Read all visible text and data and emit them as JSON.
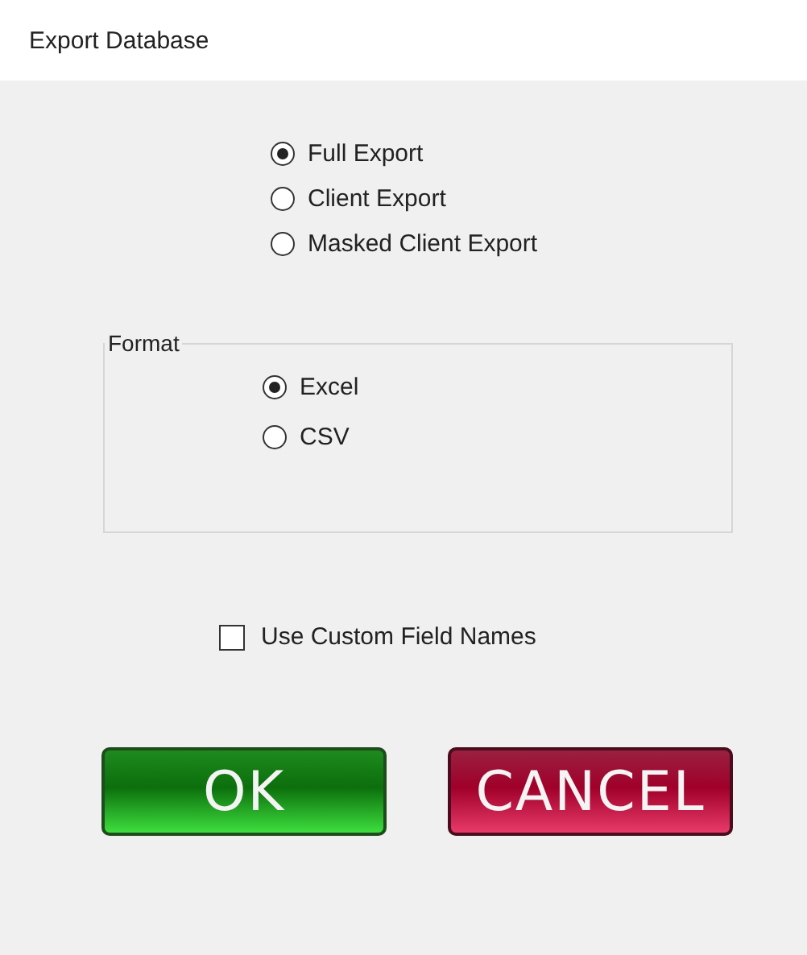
{
  "window": {
    "title": "Export Database"
  },
  "export_types": [
    {
      "label": "Full Export",
      "selected": true
    },
    {
      "label": "Client Export",
      "selected": false
    },
    {
      "label": "Masked Client Export",
      "selected": false
    }
  ],
  "format": {
    "legend": "Format",
    "options": [
      {
        "label": "Excel",
        "selected": true
      },
      {
        "label": "CSV",
        "selected": false
      }
    ]
  },
  "custom_field_names": {
    "label": "Use Custom Field Names",
    "checked": false
  },
  "buttons": [
    {
      "label": "OK",
      "kind": "ok"
    },
    {
      "label": "CANCEL",
      "kind": "cancel"
    }
  ]
}
